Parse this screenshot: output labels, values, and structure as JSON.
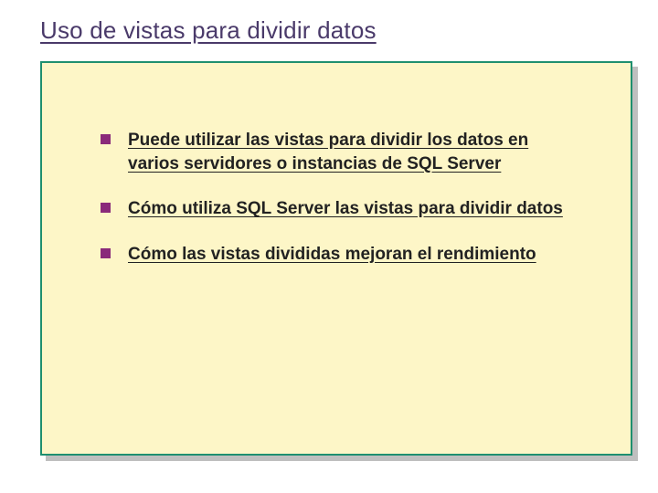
{
  "slide": {
    "title": "Uso de vistas para dividir datos",
    "bullets": [
      "Puede utilizar las vistas para dividir los datos en varios servidores o instancias de SQL Server",
      "Cómo utiliza SQL Server las vistas para dividir datos",
      "Cómo las vistas divididas mejoran el rendimiento"
    ]
  }
}
